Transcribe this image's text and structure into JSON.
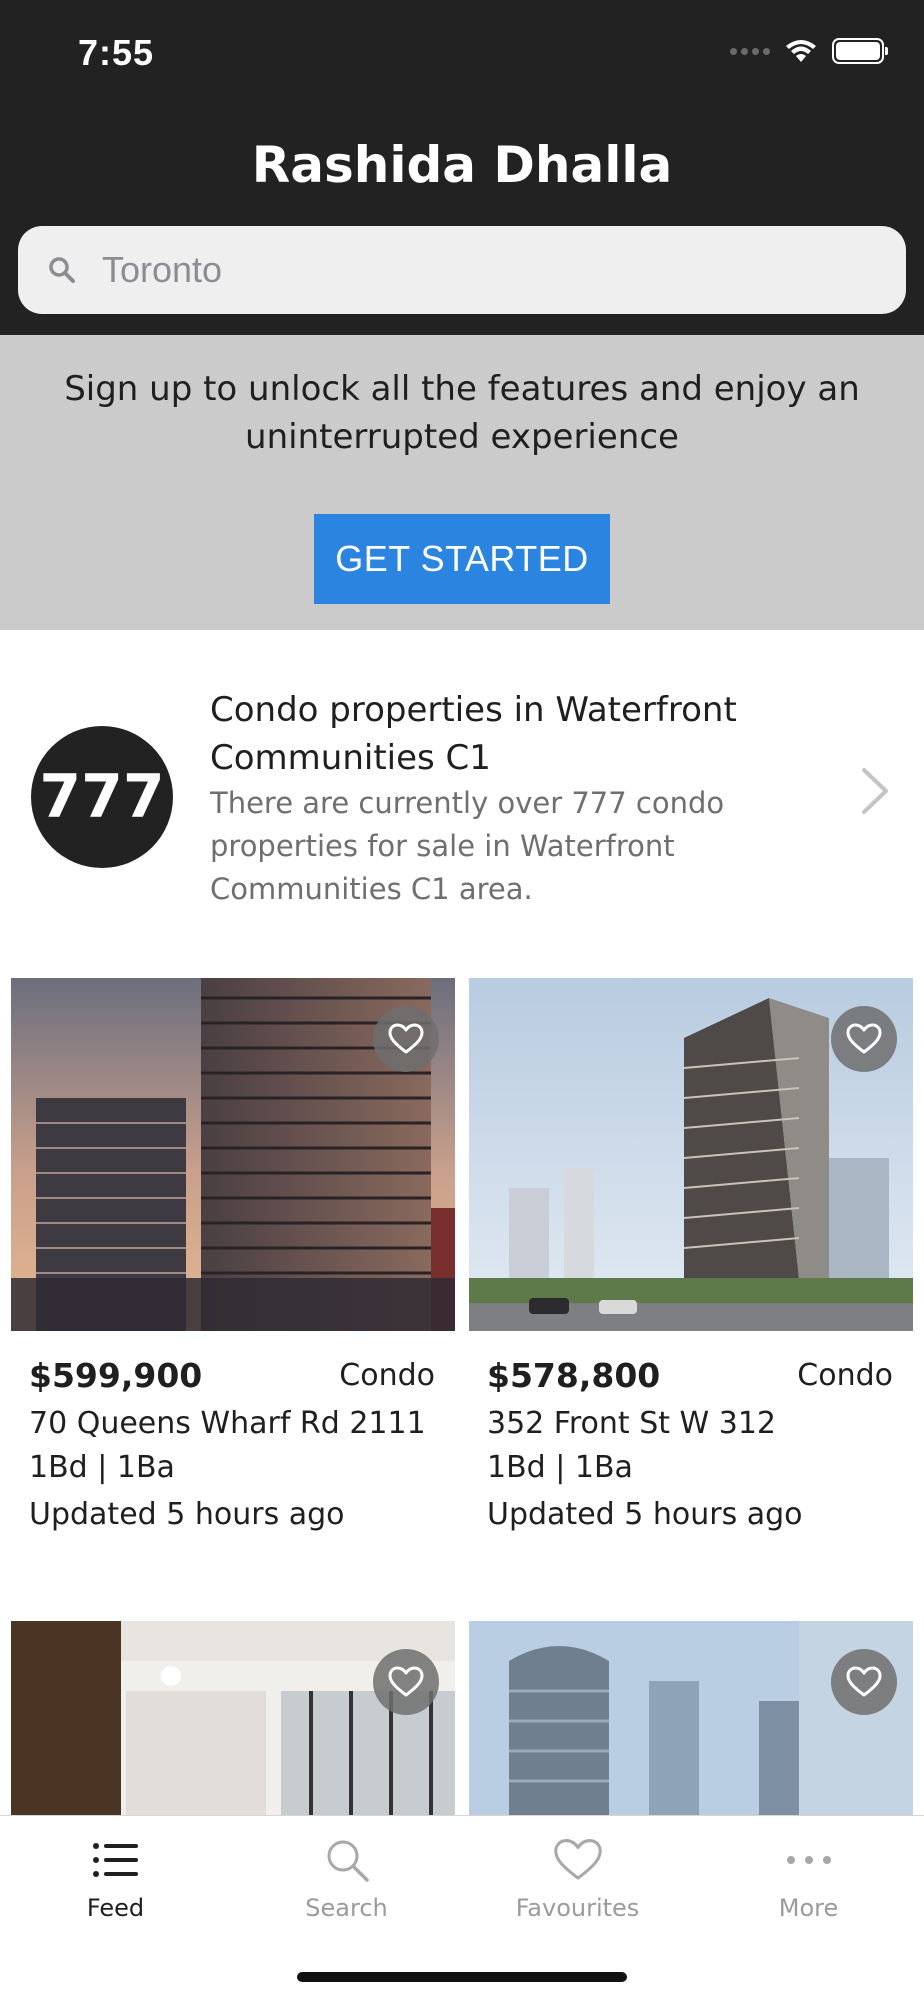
{
  "status_bar": {
    "time": "7:55"
  },
  "header": {
    "title": "Rashida Dhalla"
  },
  "search": {
    "value": "Toronto"
  },
  "signup_banner": {
    "text": "Sign up to unlock all the features and enjoy an uninterrupted experience",
    "button_label": "GET STARTED",
    "button_color": "#2b85e0"
  },
  "promo": {
    "count": "777",
    "title": "Condo properties in Waterfront Communities C1",
    "description": "There are currently over 777 condo properties for sale in Waterfront Communities C1 area."
  },
  "listings": [
    {
      "price": "$599,900",
      "type": "Condo",
      "address": "70 Queens Wharf Rd 2111",
      "beds_baths": "1Bd | 1Ba",
      "updated": "Updated 5 hours ago"
    },
    {
      "price": "$578,800",
      "type": "Condo",
      "address": "352 Front St W 312",
      "beds_baths": "1Bd | 1Ba",
      "updated": "Updated 5 hours ago"
    }
  ],
  "tabs": [
    {
      "label": "Feed",
      "icon": "list-icon",
      "active": true
    },
    {
      "label": "Search",
      "icon": "search-icon",
      "active": false
    },
    {
      "label": "Favourites",
      "icon": "heart-icon",
      "active": false
    },
    {
      "label": "More",
      "icon": "more-icon",
      "active": false
    }
  ],
  "colors": {
    "header_bg": "#222222",
    "banner_bg": "#cbcbcb",
    "accent": "#2b85e0"
  }
}
